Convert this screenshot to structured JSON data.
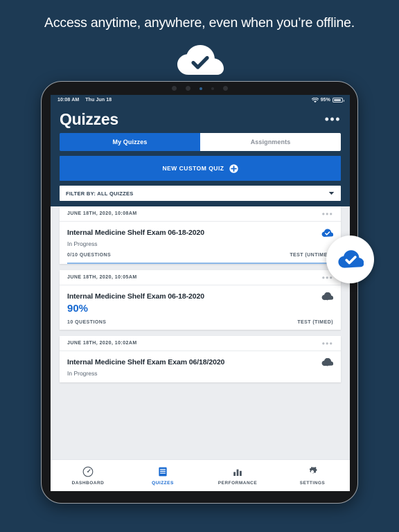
{
  "hero": {
    "headline": "Access anytime, anywhere, even when you’re offline.",
    "icon": "cloud-check-icon"
  },
  "device": {
    "status_bar": {
      "time": "10:08 AM",
      "date": "Thu Jun 18",
      "wifi_icon": "wifi-icon",
      "battery_percent": "95%",
      "battery_icon": "battery-icon"
    },
    "app_header": {
      "title": "Quizzes",
      "overflow_menu": "•••"
    },
    "tabs": [
      {
        "label": "My Quizzes",
        "active": true
      },
      {
        "label": "Assignments",
        "active": false
      }
    ],
    "new_quiz_button": {
      "label": "NEW CUSTOM QUIZ",
      "icon": "plus-circle-icon"
    },
    "filter": {
      "label": "FILTER BY: ALL QUIZZES",
      "chevron": "chevron-down-icon"
    },
    "quiz_cards": [
      {
        "date": "JUNE 18TH, 2020, 10:08AM",
        "title": "Internal Medicine Shelf Exam 06-18-2020",
        "status": "In Progress",
        "score": "",
        "questions": "0/10 QUESTIONS",
        "type": "TEST (UNTIMED)",
        "sync_icon": "cloud-check-icon",
        "menu": "•••",
        "has_progress_bar": true
      },
      {
        "date": "JUNE 18TH, 2020, 10:05AM",
        "title": "Internal Medicine Shelf Exam 06-18-2020",
        "status": "",
        "score": "90%",
        "questions": "10 QUESTIONS",
        "type": "TEST (TIMED)",
        "sync_icon": "cloud-download-icon",
        "menu": "•••",
        "has_progress_bar": false
      },
      {
        "date": "JUNE 18TH, 2020, 10:02AM",
        "title": "Internal Medicine Shelf Exam Exam 06/18/2020",
        "status": "In Progress",
        "score": "",
        "questions": "",
        "type": "",
        "sync_icon": "cloud-download-icon",
        "menu": "•••",
        "has_progress_bar": false
      }
    ],
    "bottom_nav": [
      {
        "label": "DASHBOARD",
        "icon": "speedometer-icon",
        "active": false
      },
      {
        "label": "QUIZZES",
        "icon": "list-icon",
        "active": true
      },
      {
        "label": "PERFORMANCE",
        "icon": "bar-chart-icon",
        "active": false
      },
      {
        "label": "SETTINGS",
        "icon": "gear-icon",
        "active": false
      }
    ]
  },
  "callout": {
    "icon": "cloud-check-icon"
  },
  "colors": {
    "background": "#1d3a54",
    "accent_blue": "#1668d0",
    "card_bg": "#ffffff",
    "list_bg": "#ebedf0",
    "progress_bar": "#8cb8e8"
  }
}
